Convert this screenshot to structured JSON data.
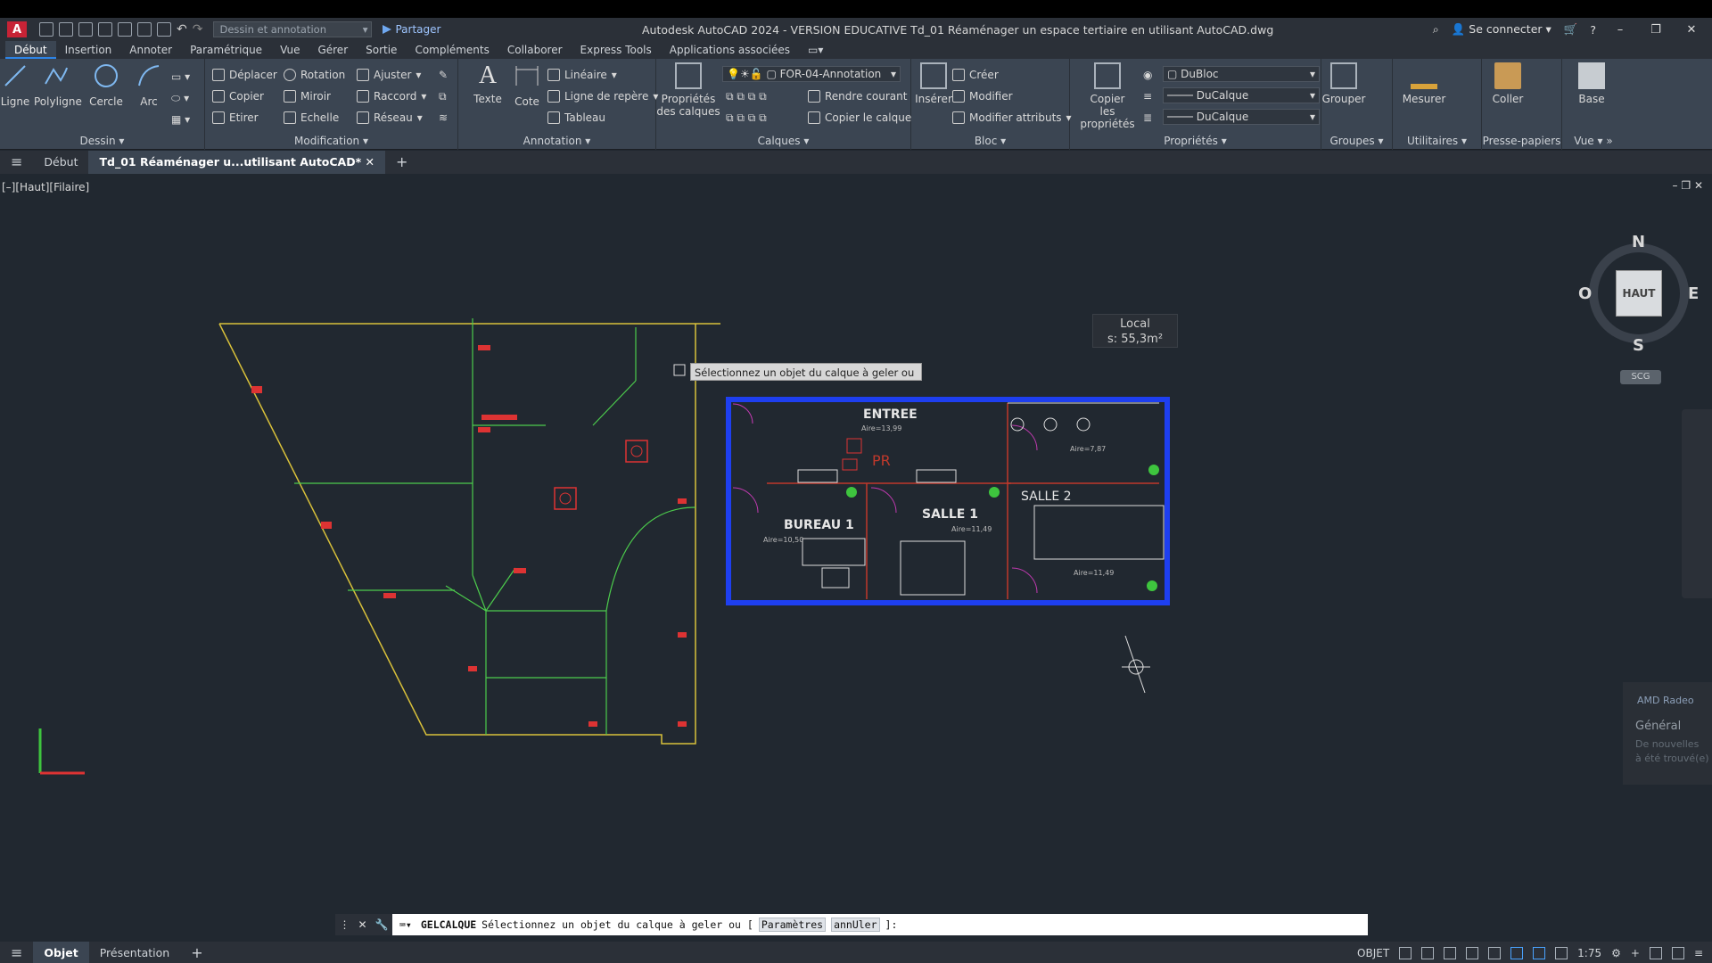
{
  "app": {
    "title": "Autodesk AutoCAD 2024 - VERSION EDUCATIVE    Td_01 Réaménager un espace tertiaire en utilisant AutoCAD.dwg",
    "logo": "A",
    "workspace": "Dessin et annotation",
    "share": "Partager",
    "signin": "Se connecter",
    "accent_color": "#2d84e6"
  },
  "menu": [
    "Début",
    "Insertion",
    "Annoter",
    "Paramétrique",
    "Vue",
    "Gérer",
    "Sortie",
    "Compléments",
    "Collaborer",
    "Express Tools",
    "Applications associées"
  ],
  "ribbon": {
    "dessin": {
      "label": "Dessin",
      "tools": [
        "Ligne",
        "Polyligne",
        "Cercle",
        "Arc"
      ]
    },
    "modification": {
      "label": "Modification",
      "tools": [
        "Déplacer",
        "Rotation",
        "Ajuster",
        "Copier",
        "Miroir",
        "Raccord",
        "Etirer",
        "Echelle",
        "Réseau"
      ]
    },
    "annotation": {
      "label": "Annotation",
      "big": [
        "Texte",
        "Cote"
      ],
      "tools": [
        "Linéaire",
        "Ligne de repère",
        "Tableau"
      ]
    },
    "calques": {
      "label": "Calques",
      "big": "Propriétés des calques",
      "big_line1": "Propriétés",
      "big_line2": "des calques",
      "layer": "FOR-04-Annotation",
      "tools": [
        "Rendre courant",
        "Copier le calque"
      ]
    },
    "bloc": {
      "label": "Bloc",
      "big": "Insérer",
      "tools": [
        "Créer",
        "Modifier",
        "Modifier attributs"
      ]
    },
    "proprietes": {
      "label": "Propriétés",
      "big_line1": "Copier",
      "big_line2": "les propriétés",
      "color": "DuBloc",
      "linetype": "DuCalque",
      "lineweight": "DuCalque"
    },
    "groupes": {
      "label": "Groupes",
      "big": "Grouper"
    },
    "utilitaires": {
      "label": "Utilitaires",
      "big": "Mesurer"
    },
    "presse": {
      "label": "Presse-papiers",
      "big": "Coller"
    },
    "vue": {
      "label": "Vue",
      "big": "Base"
    }
  },
  "doctabs": [
    "Début",
    "Td_01 Réaménager u...utilisant AutoCAD*"
  ],
  "viewport": {
    "label": "[–][Haut][Filaire]",
    "tooltip": "Sélectionnez un objet du calque à geler ou",
    "local_title": "Local",
    "local_area": "s: 55,3m²"
  },
  "plan_labels": {
    "entree": "ENTREE",
    "entree_area": "Aire=13,99",
    "pr": "PR",
    "bureau": "BUREAU 1",
    "bureau_area": "Aire=10,50",
    "salle1": "SALLE 1",
    "salle1_area": "Aire=11,49",
    "salle2": "SALLE 2",
    "salle2_area": "Aire=11,49",
    "top_right_area": "Aire=7,87"
  },
  "navcube": {
    "face": "HAUT",
    "n": "N",
    "s": "S",
    "e": "E",
    "o": "O",
    "scg": "SCG"
  },
  "notification": {
    "title": "AMD Radeo",
    "heading": "Général",
    "body1": "De nouvelles",
    "body2": "à été trouvé(e)"
  },
  "command": {
    "name": "GELCALQUE",
    "prompt": "Sélectionnez un objet du calque à geler ou [",
    "opt1": "Paramètres",
    "opt2": "annUler",
    "end": "]:"
  },
  "status": {
    "tabs": [
      "Objet",
      "Présentation"
    ],
    "mode": "OBJET",
    "scale": "1:75"
  }
}
